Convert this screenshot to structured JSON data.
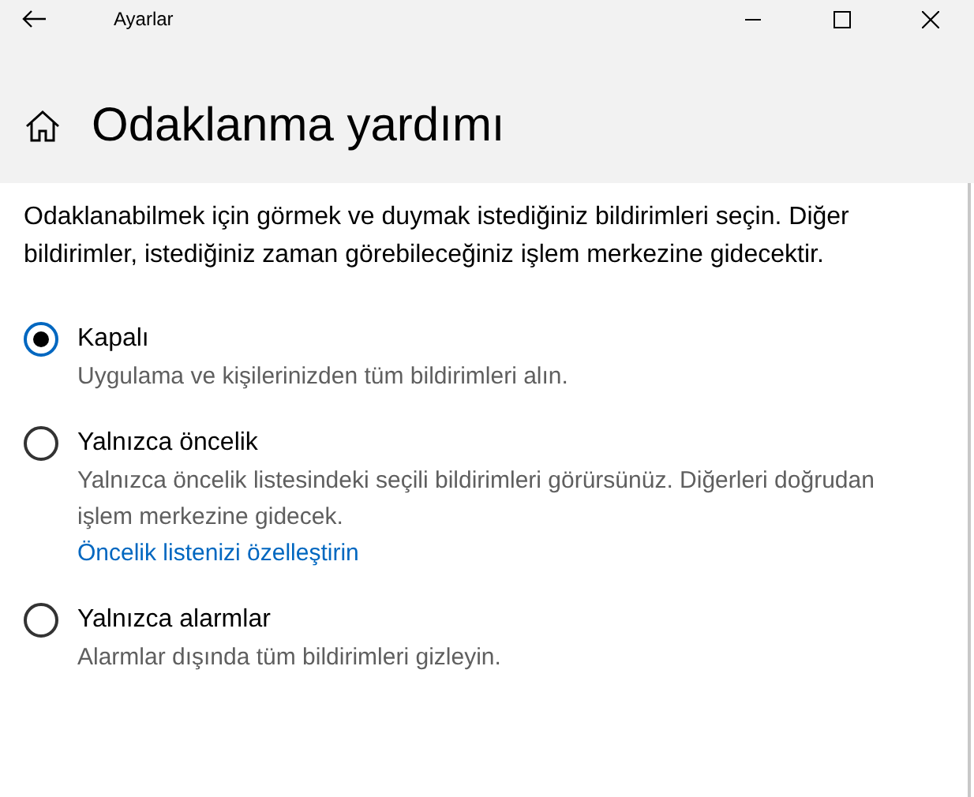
{
  "window": {
    "title": "Ayarlar"
  },
  "page": {
    "title": "Odaklanma yardımı",
    "description": "Odaklanabilmek için görmek ve duymak istediğiniz bildirimleri seçin. Diğer bildirimler, istediğiniz zaman görebileceğiniz işlem merkezine gidecektir."
  },
  "options": [
    {
      "label": "Kapalı",
      "description": "Uygulama ve kişilerinizden tüm bildirimleri alın.",
      "selected": true
    },
    {
      "label": "Yalnızca öncelik",
      "description": "Yalnızca öncelik listesindeki seçili bildirimleri görürsünüz. Diğerleri doğrudan işlem merkezine gidecek.",
      "link": "Öncelik listenizi özelleştirin",
      "selected": false
    },
    {
      "label": "Yalnızca alarmlar",
      "description": "Alarmlar dışında tüm bildirimleri gizleyin.",
      "selected": false
    }
  ]
}
